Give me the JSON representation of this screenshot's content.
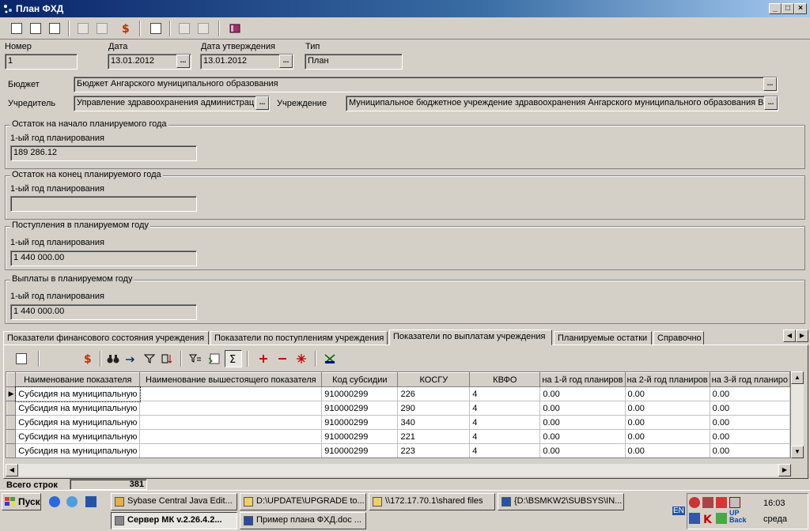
{
  "window": {
    "title": "План ФХД",
    "min": "_",
    "max": "□",
    "close": "×"
  },
  "form": {
    "number_label": "Номер",
    "number_value": "1",
    "date_label": "Дата",
    "date_value": "13.01.2012",
    "approval_date_label": "Дата утверждения",
    "approval_date_value": "13.01.2012",
    "type_label": "Тип",
    "type_value": "План",
    "budget_label": "Бюджет",
    "budget_value": "Бюджет Ангарского муниципального образования",
    "founder_label": "Учредитель",
    "founder_value": "Управление здравоохранения администрац",
    "institution_label": "Учреждение",
    "institution_value": "Муниципальное бюджетное учреждение здравоохранения Ангарского муниципального образования В",
    "dots": "..."
  },
  "groups": [
    {
      "title": "Остаток на начало планируемого года",
      "sub": "1-ый год планирования",
      "value": "189 286.12"
    },
    {
      "title": "Остаток на конец планируемого года",
      "sub": "1-ый год планирования",
      "value": ""
    },
    {
      "title": "Поступления в планируемом году",
      "sub": "1-ый год планирования",
      "value": "1 440 000.00"
    },
    {
      "title": "Выплаты в планируемом году",
      "sub": "1-ый год планирования",
      "value": "1 440 000.00"
    }
  ],
  "tabs": [
    "Показатели финансового состояния учреждения",
    "Показатели по поступлениям учреждения",
    "Показатели по выплатам учреждения",
    "Планируемые остатки",
    "Справочно"
  ],
  "grid": {
    "columns": [
      "Наименование показателя",
      "Наименование вышестоящего показателя",
      "Код субсидии",
      "КОСГУ",
      "КВФО",
      "на 1-й год планиров",
      "на 2-й год планиров",
      "на 3-й год планиро"
    ],
    "rows": [
      [
        "Субсидия на муниципальную",
        "",
        "910000299",
        "226",
        "4",
        "0.00",
        "0.00",
        "0.00"
      ],
      [
        "Субсидия на муниципальную",
        "",
        "910000299",
        "290",
        "4",
        "0.00",
        "0.00",
        "0.00"
      ],
      [
        "Субсидия на муниципальную",
        "",
        "910000299",
        "340",
        "4",
        "0.00",
        "0.00",
        "0.00"
      ],
      [
        "Субсидия на муниципальную",
        "",
        "910000299",
        "221",
        "4",
        "0.00",
        "0.00",
        "0.00"
      ],
      [
        "Субсидия на муниципальную",
        "",
        "910000299",
        "223",
        "4",
        "0.00",
        "0.00",
        "0.00"
      ]
    ],
    "total_label": "Всего строк",
    "total_value": "381"
  },
  "taskbar": {
    "start": "Пуск",
    "buttons_row1": [
      "Sybase Central Java Edit...",
      "D:\\UPDATE\\UPGRADE to...",
      "\\\\172.17.70.1\\shared files",
      "{D:\\BSMKW2\\SUBSYS\\IN..."
    ],
    "buttons_row2": [
      "Сервер МК v.2.26.4.2...",
      "Пример плана ФХД.doc ..."
    ],
    "lang": "EN",
    "time": "16:03",
    "day": "среда"
  },
  "colors": {
    "title_start": "#0a246a",
    "face": "#d4d0c8"
  }
}
